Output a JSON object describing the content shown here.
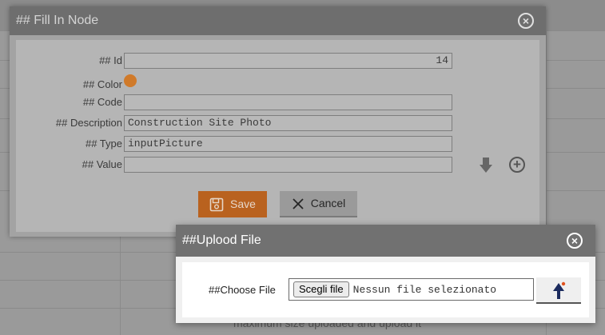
{
  "background": {
    "footer_text": "maximum size uploaded and upload it"
  },
  "fill_node_dialog": {
    "title": "## Fill In Node",
    "fields": {
      "id": {
        "label": "## Id",
        "value": "14"
      },
      "color": {
        "label": "## Color",
        "value": "#d07a2a"
      },
      "code": {
        "label": "## Code",
        "value": ""
      },
      "description": {
        "label": "## Description",
        "value": "Construction Site Photo"
      },
      "type": {
        "label": "## Type",
        "value": "inputPicture"
      },
      "value": {
        "label": "## Value",
        "value": ""
      }
    },
    "save_label": "Save",
    "cancel_label": "Cancel",
    "icons": {
      "close": "close-icon",
      "download": "arrow-down-icon",
      "add": "plus-circle-icon",
      "save": "floppy-icon",
      "cancel": "x-icon"
    }
  },
  "upload_dialog": {
    "title": "##Uplood File",
    "choose_label": "##Choose File",
    "file_button_label": "Scegli file",
    "file_status": "Nessun file selezionato",
    "icons": {
      "close": "close-icon",
      "upload": "arrow-up-icon"
    },
    "accent_color": "#1b2b5e",
    "dot_color": "#e0531f"
  }
}
